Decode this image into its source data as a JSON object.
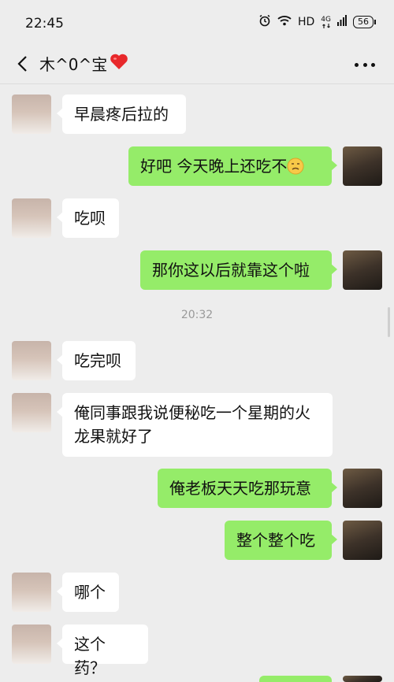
{
  "status_bar": {
    "time": "22:45",
    "hd": "HD",
    "network": "4G",
    "battery": "56"
  },
  "header": {
    "contact_name": "木^0^宝"
  },
  "messages": [
    {
      "side": "left",
      "text": "早晨疼后拉的"
    },
    {
      "side": "right",
      "text": "好吧  今天晚上还吃不"
    },
    {
      "side": "left",
      "text": "吃呗"
    },
    {
      "side": "right",
      "text": "那你这以后就靠这个啦"
    },
    {
      "timestamp": "20:32"
    },
    {
      "side": "left",
      "text": "吃完呗"
    },
    {
      "side": "left",
      "text": "俺同事跟我说便秘吃一个星期的火龙果就好了"
    },
    {
      "side": "right",
      "text": "俺老板天天吃那玩意"
    },
    {
      "side": "right",
      "text": "整个整个吃"
    },
    {
      "side": "left",
      "text": "哪个"
    },
    {
      "side": "left",
      "text": "这个药？"
    }
  ],
  "colors": {
    "sent_bubble": "#95ec69",
    "received_bubble": "#ffffff",
    "background": "#ededed"
  }
}
